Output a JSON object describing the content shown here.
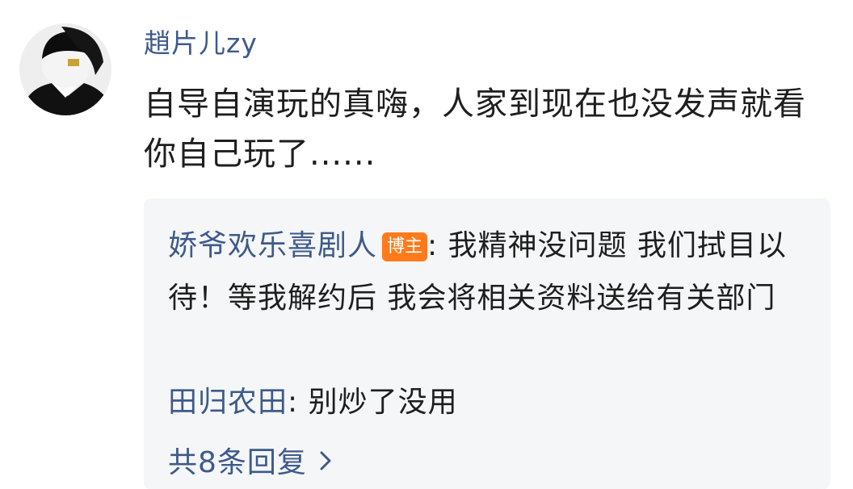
{
  "comment": {
    "username": "趙片儿zy",
    "text": "自导自演玩的真嗨，人家到现在也没发声就看你自己玩了......"
  },
  "replies": [
    {
      "author": "娇爷欢乐喜剧人",
      "badge": "博主",
      "text": ": 我精神没问题 我们拭目以待！等我解约后 我会将相关资料送给有关部门"
    },
    {
      "author": "田归农田",
      "text": ": 别炒了没用"
    }
  ],
  "more_replies": {
    "label": "共8条回复",
    "icon": "chevron-right-icon"
  },
  "colors": {
    "link": "#3d5a8a",
    "badge": "#ff7a1a",
    "reply_background": "#f5f6f8"
  }
}
